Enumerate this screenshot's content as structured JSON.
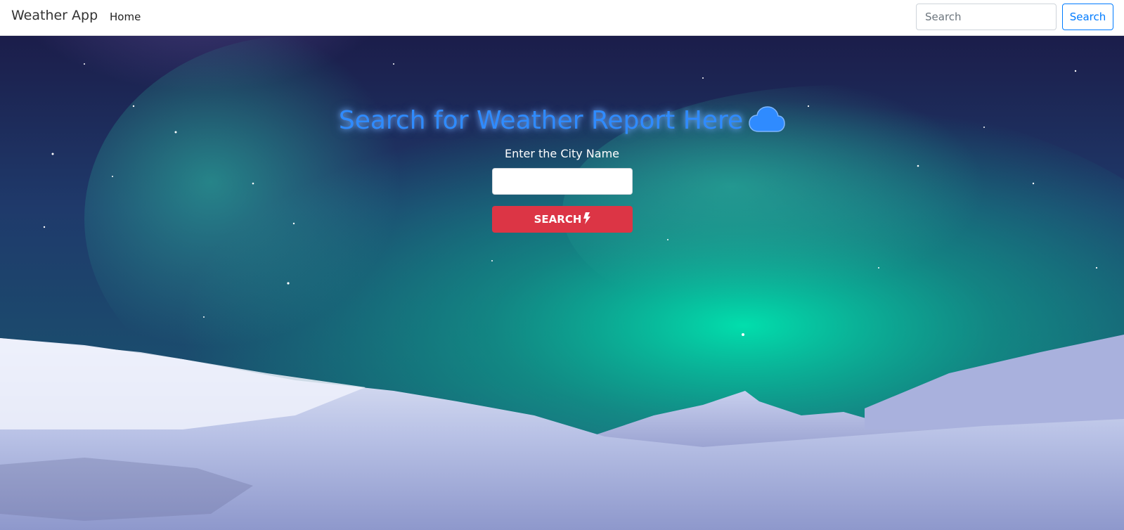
{
  "navbar": {
    "brand": "Weather App",
    "home_label": "Home",
    "search_placeholder": "Search",
    "search_button": "Search"
  },
  "hero": {
    "heading": "Search for Weather Report Here",
    "heading_icon": "cloud-icon",
    "city_label": "Enter the City Name",
    "city_input_value": "",
    "submit_label": "SEARCH",
    "submit_icon": "bolt-icon"
  },
  "colors": {
    "heading": "#2f8bff",
    "submit_bg": "#dc3545",
    "nav_button": "#007bff"
  }
}
